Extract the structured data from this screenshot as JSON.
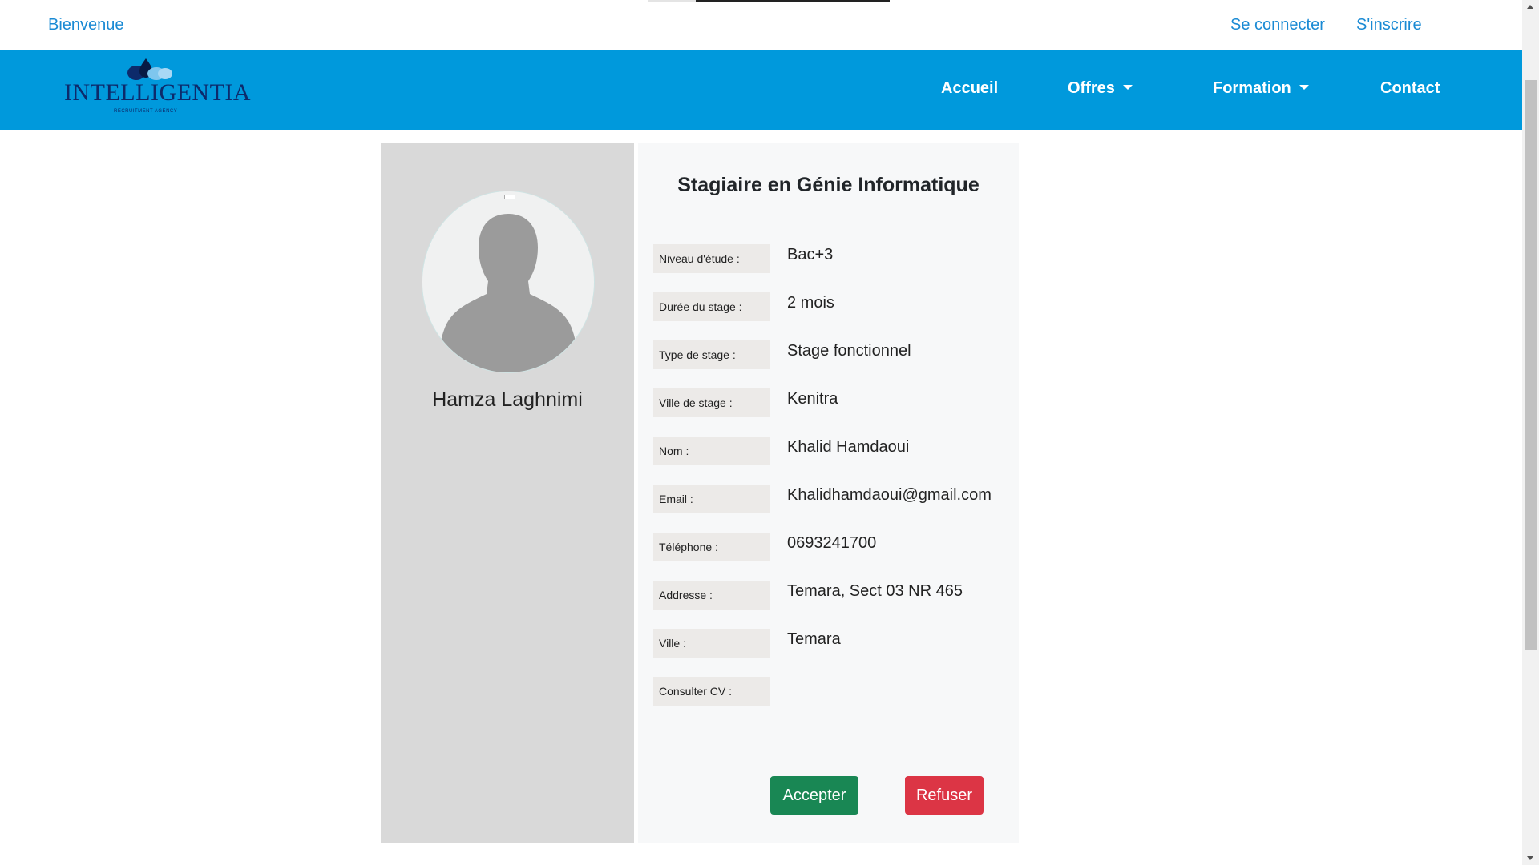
{
  "topbar": {
    "welcome": "Bienvenue",
    "login": "Se connecter",
    "signup": "S'inscrire"
  },
  "brand": {
    "name": "INTELLIGENTIA",
    "tagline": "RECRUITMENT AGENCY",
    "logo_icon": "droplets-icon"
  },
  "nav": {
    "home": "Accueil",
    "offres": "Offres",
    "formation": "Formation",
    "contact": "Contact"
  },
  "profile": {
    "avatar_icon": "user-silhouette-icon",
    "name": "Hamza Laghnimi"
  },
  "offer": {
    "title": "Stagiaire en Génie Informatique",
    "fields": [
      {
        "label": "Niveau d'étude :",
        "value": "Bac+3"
      },
      {
        "label": "Durée du stage :",
        "value": "2 mois"
      },
      {
        "label": "Type de stage :",
        "value": "Stage fonctionnel"
      },
      {
        "label": "Ville de stage :",
        "value": "Kenitra"
      },
      {
        "label": "Nom :",
        "value": "Khalid Hamdaoui"
      },
      {
        "label": "Email :",
        "value": "Khalidhamdaoui@gmail.com"
      },
      {
        "label": "Téléphone :",
        "value": "0693241700"
      },
      {
        "label": "Addresse :",
        "value": "Temara, Sect 03 NR 465"
      },
      {
        "label": "Ville :",
        "value": "Temara"
      },
      {
        "label": "Consulter CV :",
        "value": ""
      }
    ]
  },
  "actions": {
    "accept": "Accepter",
    "refuse": "Refuser"
  },
  "colors": {
    "navbar": "#0099dc",
    "link": "#1a8ad4",
    "accept": "#198754",
    "refuse": "#dc3545"
  }
}
